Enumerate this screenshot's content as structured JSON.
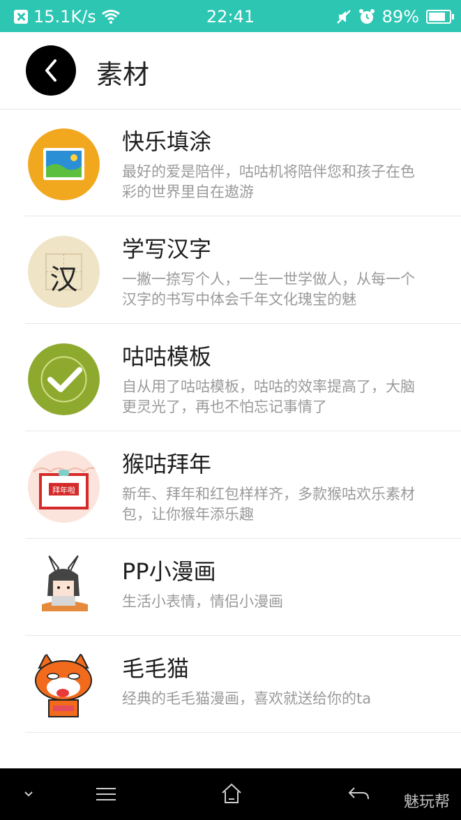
{
  "status_bar": {
    "speed": "15.1K/s",
    "time": "22:41",
    "battery": "89%"
  },
  "header": {
    "title": "素材"
  },
  "items": [
    {
      "title": "快乐填涂",
      "desc": "最好的爱是陪伴，咕咕机将陪伴您和孩子在色彩的世界里自在遨游"
    },
    {
      "title": "学写汉字",
      "desc": "一撇一捺写个人，一生一世学做人，从每一个汉字的书写中体会千年文化瑰宝的魅",
      "icon_char": "汉"
    },
    {
      "title": "咕咕模板",
      "desc": "自从用了咕咕模板，咕咕的效率提高了，大脑更灵光了，再也不怕忘记事情了"
    },
    {
      "title": "猴咕拜年",
      "desc": "新年、拜年和红包样样齐，多款猴咕欢乐素材包，让你猴年添乐趣",
      "icon_text": "拜年啦"
    },
    {
      "title": "PP小漫画",
      "desc": "生活小表情，情侣小漫画"
    },
    {
      "title": "毛毛猫",
      "desc": "经典的毛毛猫漫画，喜欢就送给你的ta"
    }
  ],
  "navbar": {
    "watermark": "魅玩帮"
  },
  "colors": {
    "status_bar": "#2cc6b3",
    "title_text": "#1e1e1e",
    "desc_text": "#9a9a9a"
  }
}
